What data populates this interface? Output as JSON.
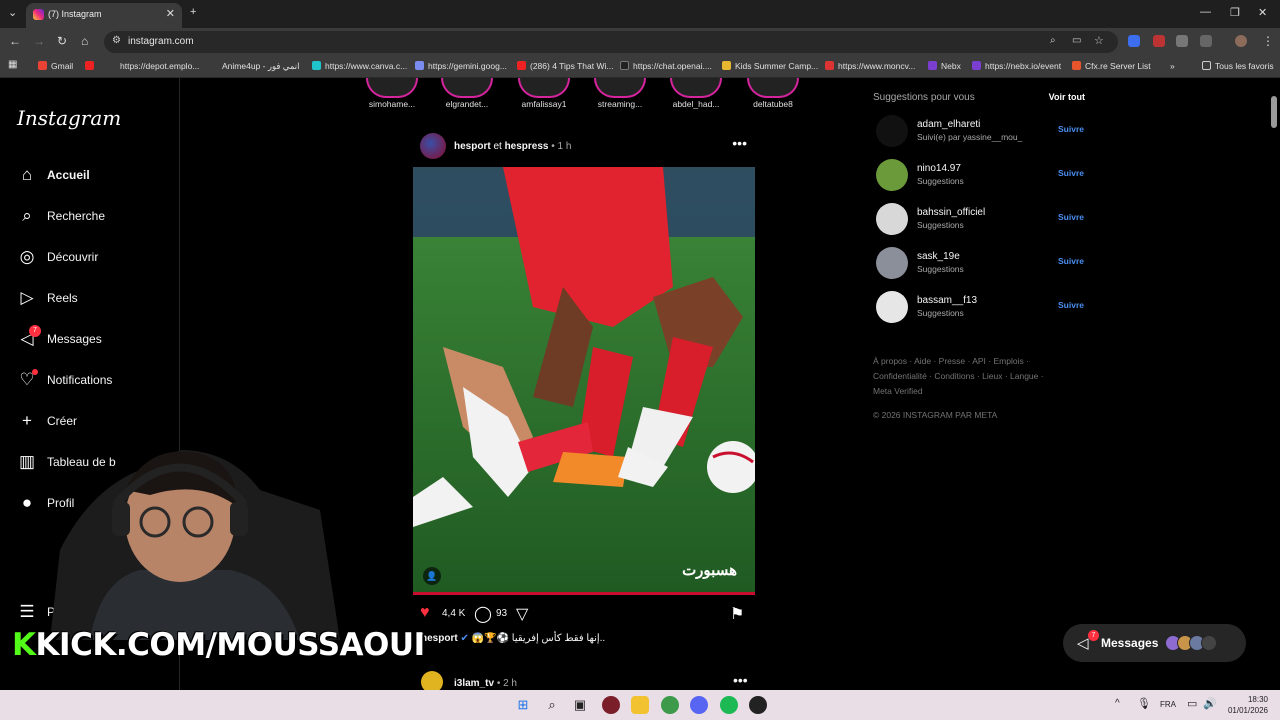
{
  "browser": {
    "tab_title": "(7) Instagram",
    "url": "instagram.com",
    "bookmarks": [
      "Gmail",
      "https://depot.emplo...",
      "Anime4up - انمي فور",
      "https://www.canva.c...",
      "https://gemini.goog...",
      "(286) 4 Tips That Wi...",
      "https://chat.openai....",
      "Kids Summer Camp...",
      "https://www.moncv...",
      "Nebx",
      "https://nebx.io/event",
      "Cfx.re Server List"
    ],
    "all_favorites": "Tous les favoris"
  },
  "instagram": {
    "logo": "Instagram",
    "nav": [
      {
        "label": "Accueil",
        "icon": "home-icon"
      },
      {
        "label": "Recherche",
        "icon": "search-icon"
      },
      {
        "label": "Découvrir",
        "icon": "compass-icon"
      },
      {
        "label": "Reels",
        "icon": "reels-icon"
      },
      {
        "label": "Messages",
        "icon": "messenger-icon",
        "badge": "7"
      },
      {
        "label": "Notifications",
        "icon": "heart-icon"
      },
      {
        "label": "Créer",
        "icon": "plus-icon"
      },
      {
        "label": "Tableau de b",
        "icon": "dashboard-icon"
      },
      {
        "label": "Profil",
        "icon": "avatar-icon"
      },
      {
        "label": "Plus",
        "icon": "menu-icon"
      }
    ],
    "stories": [
      "simohame...",
      "elgrandet...",
      "amfalissay1",
      "streaming...",
      "abdel_had...",
      "deltatube8"
    ],
    "post": {
      "author1": "hesport",
      "joiner": "et",
      "author2": "hespress",
      "time": "• 1 h",
      "likes": "4,4 K",
      "comments": "93",
      "caption_user": "hesport",
      "caption_text": "إنها فقط كأس إفريقيا..",
      "watermark": "هسبورت"
    },
    "next_post": {
      "author": "i3lam_tv",
      "time": "• 2 h"
    },
    "suggestions": {
      "title": "Suggestions pour vous",
      "see_all": "Voir tout",
      "items": [
        {
          "name": "adam_elhareti",
          "sub": "Suivi(e) par yassine__mou_",
          "follow": "Suivre",
          "color": "#111111"
        },
        {
          "name": "nino14.97",
          "sub": "Suggestions",
          "follow": "Suivre",
          "color": "#6a9a3a"
        },
        {
          "name": "bahssin_officiel",
          "sub": "Suggestions",
          "follow": "Suivre",
          "color": "#d8d8d8"
        },
        {
          "name": "sask_19e",
          "sub": "Suggestions",
          "follow": "Suivre",
          "color": "#8a8f9a"
        },
        {
          "name": "bassam__f13",
          "sub": "Suggestions",
          "follow": "Suivre",
          "color": "#e6e6e6"
        }
      ]
    },
    "footer_links": "À propos · Aide · Presse · API · Emplois · Confidentialité · Conditions · Lieux · Langue · Meta Verified",
    "copyright": "© 2026 INSTAGRAM PAR META",
    "messages_pill": {
      "label": "Messages",
      "badge": "7"
    }
  },
  "overlay": {
    "kick_prefix": "K",
    "kick_text": "KICK.COM/MOUSSAOUI"
  },
  "taskbar": {
    "lang": "FRA",
    "time": "18:30",
    "date": "01/01/2026"
  }
}
